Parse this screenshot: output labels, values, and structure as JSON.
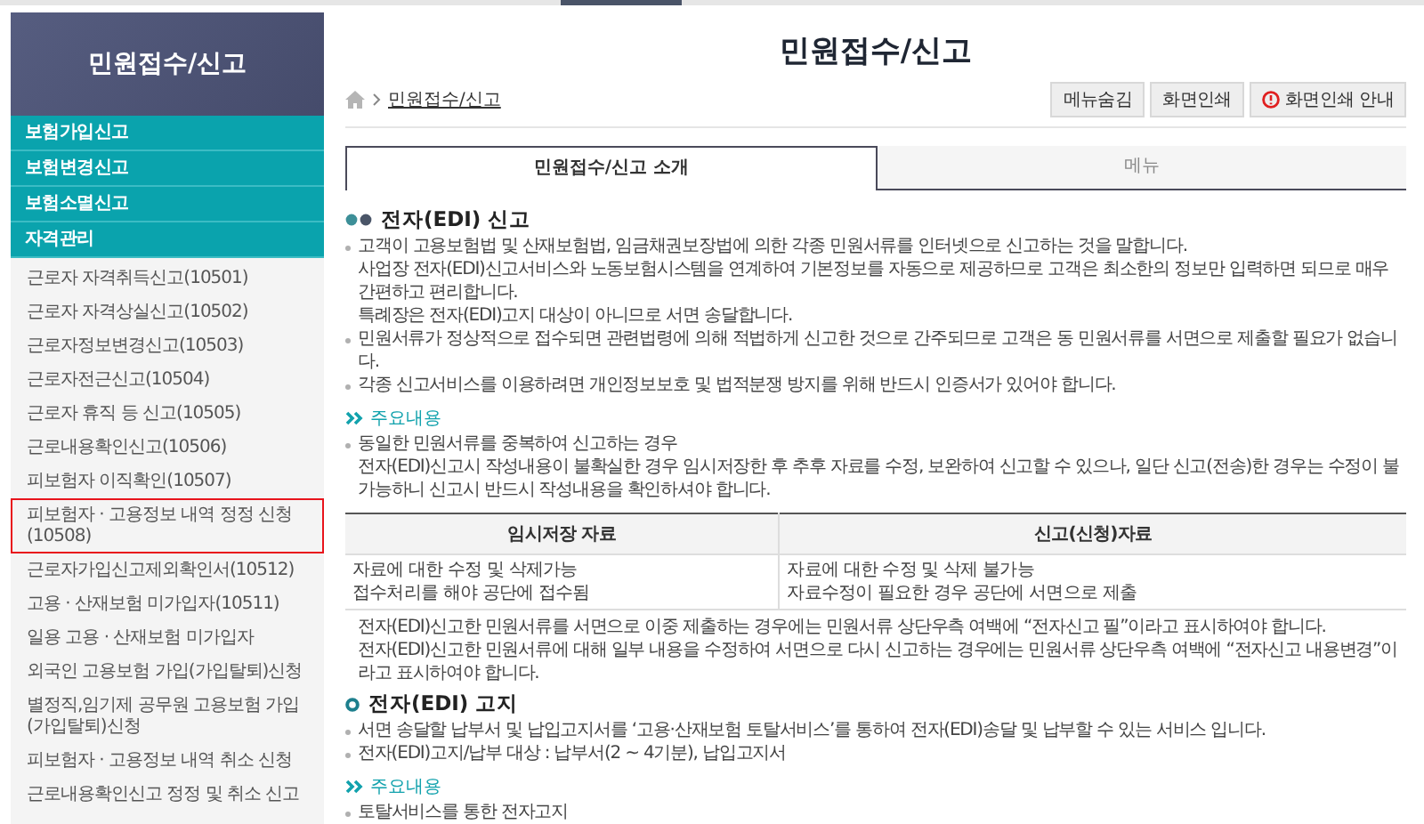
{
  "sidebar": {
    "title": "민원접수/신고",
    "groups": [
      {
        "label": "보험가입신고"
      },
      {
        "label": "보험변경신고"
      },
      {
        "label": "보험소멸신고"
      },
      {
        "label": "자격관리"
      }
    ],
    "items": [
      {
        "label": "근로자 자격취득신고(10501)",
        "selected": false
      },
      {
        "label": "근로자 자격상실신고(10502)",
        "selected": false
      },
      {
        "label": "근로자정보변경신고(10503)",
        "selected": false
      },
      {
        "label": "근로자전근신고(10504)",
        "selected": false
      },
      {
        "label": "근로자 휴직 등 신고(10505)",
        "selected": false
      },
      {
        "label": "근로내용확인신고(10506)",
        "selected": false
      },
      {
        "label": "피보험자 이직확인(10507)",
        "selected": false
      },
      {
        "label": "피보험자 · 고용정보 내역 정정 신청(10508)",
        "selected": true
      },
      {
        "label": "근로자가입신고제외확인서(10512)",
        "selected": false
      },
      {
        "label": "고용 · 산재보험 미가입자(10511)",
        "selected": false
      },
      {
        "label": "일용 고용 · 산재보험 미가입자",
        "selected": false
      },
      {
        "label": "외국인 고용보험 가입(가입탈퇴)신청",
        "selected": false
      },
      {
        "label": "별정직,임기제 공무원 고용보험 가입(가입탈퇴)신청",
        "selected": false
      },
      {
        "label": "피보험자 · 고용정보 내역 취소 신청",
        "selected": false
      },
      {
        "label": "근로내용확인신고 정정 및 취소 신고",
        "selected": false
      }
    ]
  },
  "page": {
    "title": "민원접수/신고",
    "breadcrumb": "민원접수/신고",
    "buttons": [
      {
        "label": "메뉴숨김",
        "kind": "plain"
      },
      {
        "label": "화면인쇄",
        "kind": "plain"
      },
      {
        "label": "화면인쇄 안내",
        "kind": "info"
      }
    ]
  },
  "tabs": [
    {
      "label": "민원접수/신고 소개",
      "selected": true
    },
    {
      "label": "메뉴",
      "selected": false
    }
  ],
  "content": [
    {
      "kind": "heading",
      "text": "전자(EDI) 신고"
    },
    {
      "kind": "bullet",
      "lines": [
        "고객이 고용보험법 및 산재보험법, 임금채권보장법에 의한 각종 민원서류를 인터넷으로 신고하는 것을 말합니다.",
        "사업장 전자(EDI)신고서비스와 노동보험시스템을 연계하여 기본정보를 자동으로 제공하므로 고객은 최소한의 정보만 입력하면 되므로 매우 간편하고 편리합니다.",
        "특례장은 전자(EDI)고지 대상이 아니므로 서면 송달합니다."
      ]
    },
    {
      "kind": "bullet",
      "lines": [
        "민원서류가 정상적으로 접수되면 관련법령에 의해 적법하게 신고한 것으로 간주되므로 고객은 동 민원서류를 서면으로 제출할 필요가 없습니다."
      ]
    },
    {
      "kind": "bullet",
      "lines": [
        "각종 신고서비스를 이용하려면 개인정보보호 및 법적분쟁 방지를 위해 반드시 인증서가 있어야 합니다."
      ]
    },
    {
      "kind": "subheading",
      "text": "주요내용"
    },
    {
      "kind": "bullet",
      "lines": [
        "동일한 민원서류를 중복하여 신고하는 경우",
        "전자(EDI)신고시 작성내용이 불확실한 경우 임시저장한 후 추후 자료를 수정, 보완하여 신고할 수 있으나, 일단 신고(전송)한 경우는 수정이 불가능하니 신고시 반드시 작성내용을 확인하셔야 합니다."
      ]
    },
    {
      "kind": "table",
      "columns": [
        "임시저장 자료",
        "신고(신청)자료"
      ],
      "rows": [
        [
          "자료에 대한 수정 및 삭제가능",
          "자료에 대한 수정 및 삭제 불가능"
        ],
        [
          "접수처리를 해야 공단에 접수됨",
          "자료수정이 필요한 경우 공단에 서면으로 제출"
        ]
      ]
    },
    {
      "kind": "note",
      "lines": [
        "전자(EDI)신고한 민원서류를 서면으로 이중 제출하는 경우에는 민원서류 상단우측 여백에 “전자신고 필”이라고 표시하여야 합니다.",
        "전자(EDI)신고한 민원서류에 대해 일부 내용을 수정하여 서면으로 다시 신고하는 경우에는 민원서류 상단우측 여백에 “전자신고 내용변경”이라고 표시하여야 합니다."
      ]
    },
    {
      "kind": "topic",
      "text": "전자(EDI) 고지"
    },
    {
      "kind": "bullet",
      "lines": [
        "서면 송달할 납부서 및 납입고지서를 ‘고용·산재보험 토탈서비스’를 통하여 전자(EDI)송달 및 납부할 수 있는 서비스 입니다."
      ]
    },
    {
      "kind": "bullet",
      "lines": [
        "전자(EDI)고지/납부 대상 : 납부서(2 ~ 4기분), 납입고지서"
      ]
    },
    {
      "kind": "subheading",
      "text": "주요내용"
    },
    {
      "kind": "bullet",
      "lines": [
        "토탈서비스를 통한 전자고지"
      ]
    }
  ]
}
